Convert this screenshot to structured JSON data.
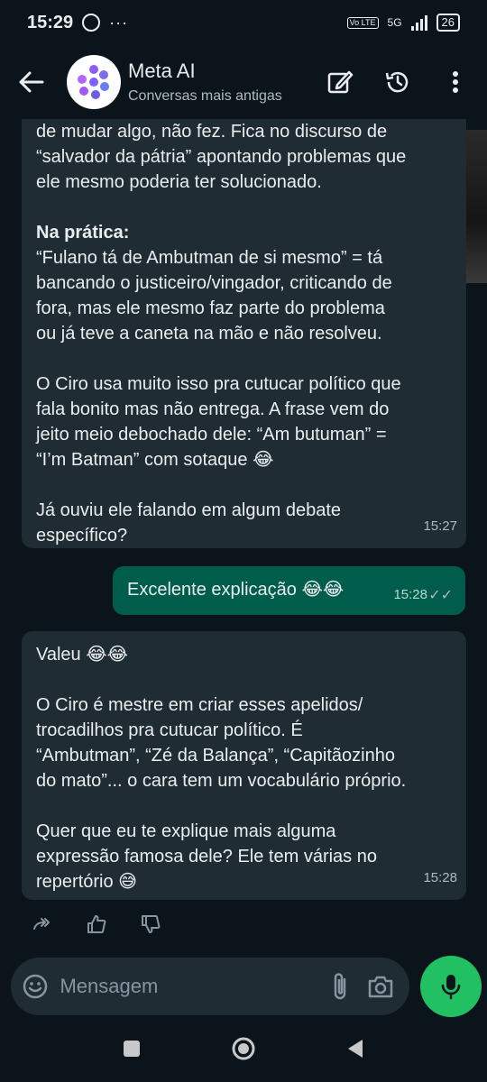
{
  "status": {
    "time": "15:29",
    "network": "5G",
    "lte": "Vo LTE",
    "battery": "26"
  },
  "header": {
    "title": "Meta AI",
    "subtitle": "Conversas mais antigas"
  },
  "messages": {
    "m1": {
      "para1": "de mudar algo, não fez. Fica no discurso de\n“salvador da pátria” apontando problemas que\nele mesmo poderia ter solucionado.",
      "heading": "Na prática:",
      "para2": "“Fulano tá de Ambutman de si mesmo” = tá\nbancando o justiceiro/vingador, criticando de\nfora, mas ele mesmo faz parte do problema\nou já teve a caneta na mão e não resolveu.",
      "para3": "O Ciro usa muito isso pra cutucar político que\nfala bonito mas não entrega. A frase vem do\njeito meio debochado dele: “Am butuman” =\n“I’m Batman” com sotaque 😂",
      "para4": "Já ouviu ele falando em algum debate\nespecífico?",
      "time": "15:27"
    },
    "m2": {
      "text": "Excelente explicação 😂😂",
      "time": "15:28"
    },
    "m3": {
      "para1": "Valeu 😂😂",
      "para2": "O Ciro é mestre em criar esses apelidos/\ntrocadilhos pra cutucar político. É\n“Ambutman”, “Zé da Balança”, “Capitãozinho\ndo mato”... o cara tem um vocabulário próprio.",
      "para3": "Quer que eu te explique mais alguma\nexpressão famosa dele? Ele tem várias no\nrepertório 😅",
      "time": "15:28"
    }
  },
  "composer": {
    "placeholder": "Mensagem"
  },
  "colors": {
    "background": "#0b141a",
    "incoming_bubble": "#202c33",
    "outgoing_bubble": "#005c4b",
    "mic_button": "#21c063"
  }
}
